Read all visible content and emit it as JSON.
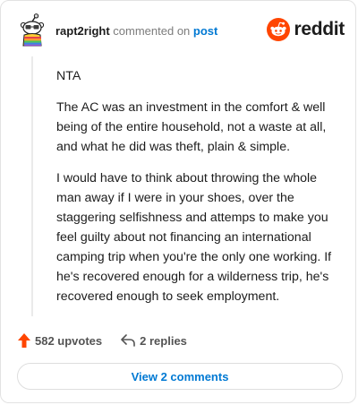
{
  "header": {
    "username": "rapt2right",
    "action_text": "commented on",
    "post_link": "post",
    "brand": "reddit",
    "avatar_icon": "snoo-avatar-icon",
    "brand_icon": "reddit-alien-icon"
  },
  "comment": {
    "paragraphs": [
      "NTA",
      "The AC was an investment in the comfort & well being of the entire household, not a waste at all, and what he did was theft, plain & simple.",
      "I would have to think about throwing the whole man away if I were in your shoes, over the staggering selfishness and attemps to make you feel guilty about not financing an international camping trip when you're the only one working. If he's recovered enough for a wilderness trip, he's recovered enough to seek employment."
    ]
  },
  "actions": {
    "upvotes": "582 upvotes",
    "replies": "2 replies",
    "upvote_icon": "upvote-arrow-icon",
    "reply_icon": "reply-arrow-icon"
  },
  "footer": {
    "view_comments": "View 2 comments"
  },
  "colors": {
    "reddit_orange": "#ff4500",
    "link_blue": "#0079d3",
    "text": "#1c1c1c",
    "muted": "#7c7c7c"
  }
}
